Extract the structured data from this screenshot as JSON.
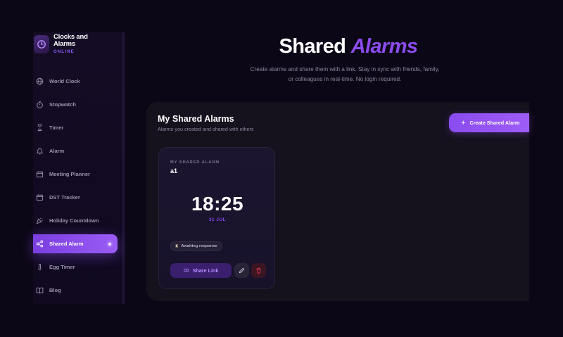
{
  "brand": {
    "name_line1": "Clocks and",
    "name_line2": "Alarms",
    "tagline": "ONLINE"
  },
  "sidebar": {
    "items": [
      {
        "label": "World Clock",
        "icon": "globe-icon"
      },
      {
        "label": "Stopwatch",
        "icon": "stopwatch-icon"
      },
      {
        "label": "Timer",
        "icon": "hourglass-icon"
      },
      {
        "label": "Alarm",
        "icon": "bell-icon"
      },
      {
        "label": "Meeting Planner",
        "icon": "calendar-icon"
      },
      {
        "label": "DST Tracker",
        "icon": "calendar-icon"
      },
      {
        "label": "Holiday Countdown",
        "icon": "party-popper-icon"
      },
      {
        "label": "Shared Alarm",
        "icon": "share-icon",
        "active": true
      },
      {
        "label": "Egg Timer",
        "icon": "thermometer-icon"
      },
      {
        "label": "Blog",
        "icon": "book-icon"
      }
    ]
  },
  "hero": {
    "title_main": "Shared",
    "title_accent": "Alarms",
    "subtitle_line1": "Create alarms and share them with a link. Stay in sync with friends, family,",
    "subtitle_line2": "or colleagues in real-time. No login required."
  },
  "panel": {
    "title": "My Shared Alarms",
    "subtitle": "Alarms you created and shared with others",
    "create_button": "Create Shared Alarm"
  },
  "alarm_card": {
    "label": "MY SHARED ALARM",
    "name": "a1",
    "time": "18:25",
    "date": "31 JUL",
    "status": "Awaiting response",
    "share_button": "Share Link"
  },
  "colors": {
    "accent": "#8b4cf0",
    "background": "#0c0716",
    "panel": "#15111d",
    "delete": "#e0344a"
  }
}
